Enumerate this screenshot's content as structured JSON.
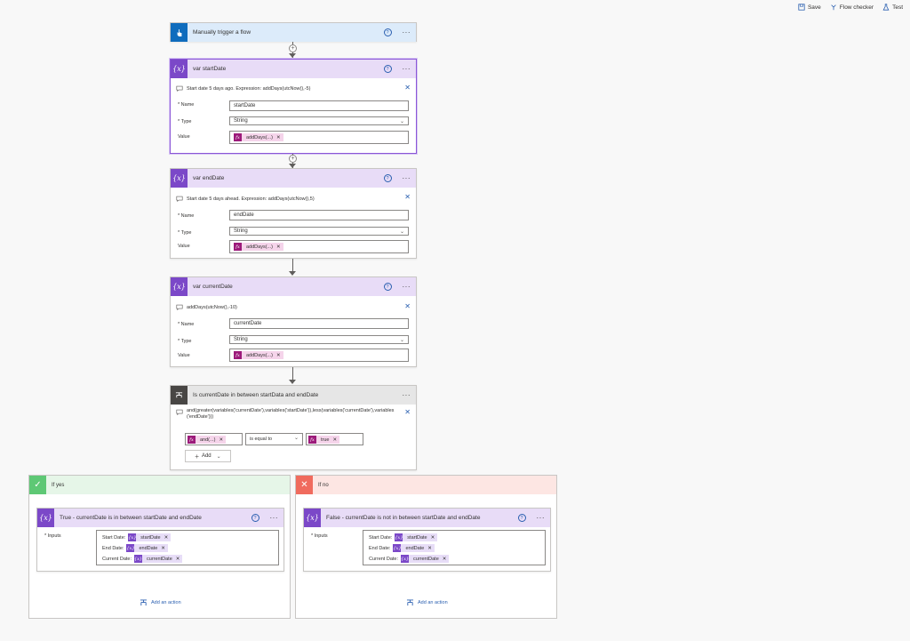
{
  "toolbar": {
    "save_label": "Save",
    "flow_checker_label": "Flow checker",
    "test_label": "Test"
  },
  "trigger": {
    "title": "Manually trigger a flow",
    "help": "?",
    "more": "···",
    "color": "#0f6cbd"
  },
  "var_start": {
    "title": "var startDate",
    "comment": "Start date 5 days ago. Expression: addDays(utcNow(),-5)",
    "name_label": "* Name",
    "name_value": "startDate",
    "type_label": "* Type",
    "type_value": "String",
    "value_label": "Value",
    "token": "addDays(...)",
    "token_icon": "fx",
    "close": "✕",
    "help": "?",
    "more": "···"
  },
  "var_end": {
    "title": "var endDate",
    "comment": "Start date 5 days ahead. Expression: addDays(utcNow(),5)",
    "name_label": "* Name",
    "name_value": "endDate",
    "type_label": "* Type",
    "type_value": "String",
    "value_label": "Value",
    "token": "addDays(...)",
    "token_icon": "fx",
    "close": "✕",
    "help": "?",
    "more": "···"
  },
  "var_current": {
    "title": "var currentDate",
    "comment": "addDays(utcNow(),-10)",
    "name_label": "* Name",
    "name_value": "currentDate",
    "type_label": "* Type",
    "type_value": "String",
    "value_label": "Value",
    "token": "addDays(...)",
    "token_icon": "fx",
    "close": "✕",
    "help": "?",
    "more": "···"
  },
  "condition": {
    "title": "Is currentDate in between startData and endDate",
    "expression": "and(greater(variables('currentDate'),variables('startDate')),less(variables('currentDate'),variables('endDate')))",
    "left_token": "and(...)",
    "operator": "is equal to",
    "right_token": "true",
    "add_label": "Add",
    "close": "✕",
    "more": "···"
  },
  "var_icon_text": "{x}",
  "branch_yes": {
    "label": "If yes",
    "action_title": "True - currentDate is in between startDate and endDate",
    "inputs_label": "* Inputs",
    "rows": [
      {
        "label": "Start Date:",
        "token": "startDate"
      },
      {
        "label": "End Date:",
        "token": "endDate"
      },
      {
        "label": "Current Date:",
        "token": "currentDate"
      }
    ],
    "add_action": "Add an action",
    "help": "?",
    "more": "···",
    "color": "#5ec875"
  },
  "branch_no": {
    "label": "If no",
    "action_title": "False - currentDate is not in between startDate and endDate",
    "inputs_label": "* Inputs",
    "rows": [
      {
        "label": "Start Date:",
        "token": "startDate"
      },
      {
        "label": "End Date:",
        "token": "endDate"
      },
      {
        "label": "Current Date:",
        "token": "currentDate"
      }
    ],
    "add_action": "Add an action",
    "help": "?",
    "more": "···",
    "color": "#f06b5e"
  },
  "colors": {
    "variable_purple": "#7b48c8",
    "variable_header_bg": "#e8dcf7",
    "trigger_header_bg": "#dcebfa",
    "condition_header_bg": "#e6e6e6",
    "yes_header_bg": "#e6f6e8",
    "no_header_bg": "#fde6e3",
    "link_blue": "#2a5fb0"
  }
}
